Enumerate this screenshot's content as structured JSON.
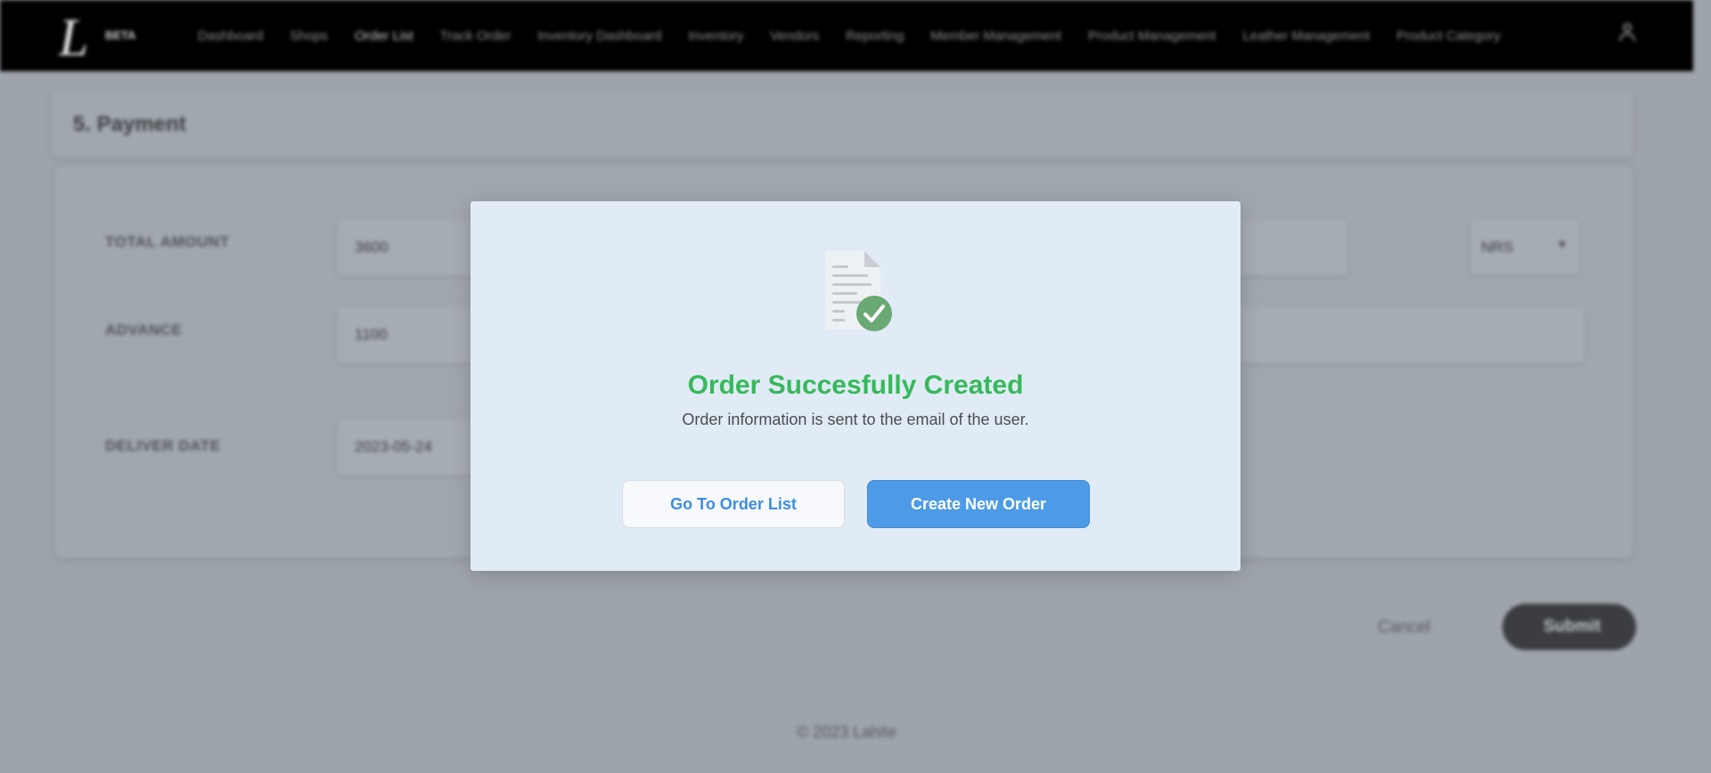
{
  "header": {
    "logo_mark": "L",
    "logo_badge": "BETA",
    "nav": [
      {
        "label": "Dashboard"
      },
      {
        "label": "Shops"
      },
      {
        "label": "Order List"
      },
      {
        "label": "Track Order"
      },
      {
        "label": "Inventory Dashboard"
      },
      {
        "label": "Inventory"
      },
      {
        "label": "Vendors"
      },
      {
        "label": "Reporting"
      },
      {
        "label": "Member Management"
      },
      {
        "label": "Product Management"
      },
      {
        "label": "Leather Management"
      },
      {
        "label": "Product Category"
      }
    ],
    "active_nav_index": 2,
    "user_icon": "user-icon"
  },
  "section": {
    "title": "5. Payment"
  },
  "form": {
    "total_amount": {
      "label": "TOTAL AMOUNT",
      "value": "3600"
    },
    "currency": {
      "value": "NRS"
    },
    "advance": {
      "label": "ADVANCE",
      "value": "1100"
    },
    "deliver_date": {
      "label": "DELIVER DATE",
      "value": "2023-05-24"
    }
  },
  "actions": {
    "cancel_label": "Cancel",
    "submit_label": "Submit"
  },
  "footer": {
    "text": "© 2023 Lahite"
  },
  "modal": {
    "icon": "document-check-icon",
    "title": "Order Succesfully Created",
    "subtitle": "Order information is sent to the email of the user.",
    "secondary_button": "Go To Order List",
    "primary_button": "Create New Order"
  },
  "colors": {
    "success": "#36b95a",
    "primary": "#4d9be6",
    "modal_bg": "#e1ebf6",
    "overlay": "#9ea4ab"
  }
}
